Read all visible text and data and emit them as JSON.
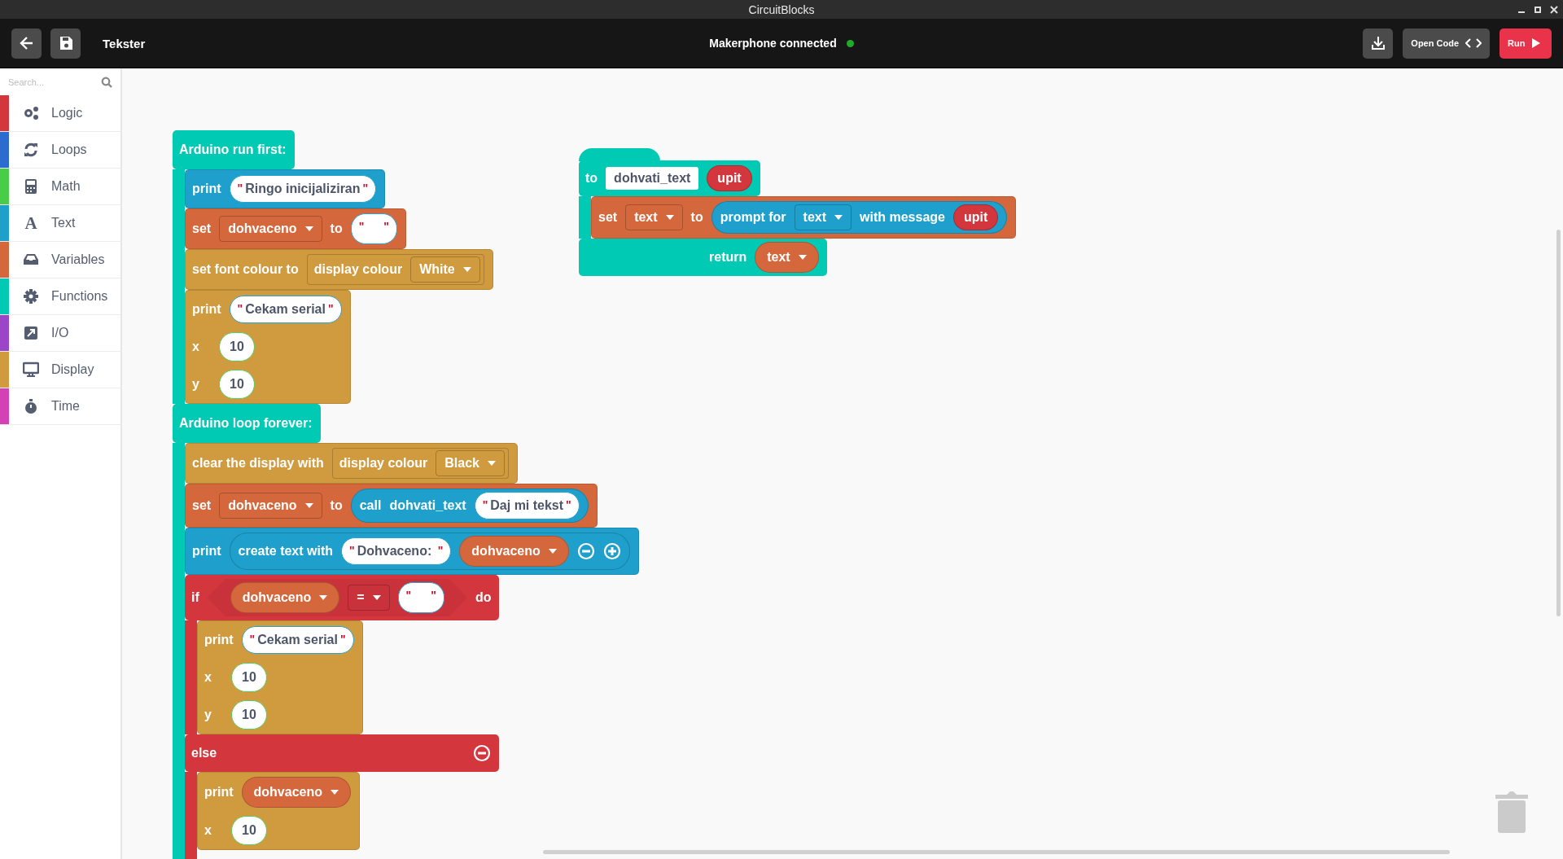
{
  "window": {
    "title": "CircuitBlocks"
  },
  "toolbar": {
    "project_name": "Tekster",
    "status": "Makerphone connected",
    "connected": true,
    "buttons": [
      {
        "kind": "open_code",
        "label": "Open Code"
      },
      {
        "kind": "run",
        "label": "Run"
      }
    ]
  },
  "sidebar": {
    "search": {
      "placeholder": "Search..."
    },
    "categories": [
      {
        "kind": "logic",
        "label": "Logic",
        "color": "#d3363d"
      },
      {
        "kind": "loops",
        "label": "Loops",
        "color": "#2d6ccf"
      },
      {
        "kind": "math",
        "label": "Math",
        "color": "#49cc47"
      },
      {
        "kind": "text",
        "label": "Text",
        "glyph": "A",
        "color": "#1fa0cb"
      },
      {
        "kind": "variables",
        "label": "Variables",
        "color": "#d4683c"
      },
      {
        "kind": "functions",
        "label": "Functions",
        "color": "#00c9b4"
      },
      {
        "kind": "io",
        "label": "I/O",
        "color": "#9b45c9"
      },
      {
        "kind": "display",
        "label": "Display",
        "color": "#d09a3f"
      },
      {
        "kind": "time",
        "label": "Time",
        "color": "#d441b4"
      }
    ]
  },
  "workspace": {
    "stacks": [
      {
        "kind": "arduino",
        "rows": [
          {
            "kind": "line",
            "parts": [
              {
                "kind": "label",
                "text": "Arduino run first:"
              }
            ]
          },
          {
            "kind": "slot",
            "blocks": [
              {
                "kind": "text",
                "rows": [
                  {
                    "kind": "line",
                    "parts": [
                      {
                        "kind": "label",
                        "text": "print"
                      },
                      {
                        "kind": "string",
                        "open": "\"",
                        "value": "Ringo inicijaliziran",
                        "close": "\""
                      }
                    ]
                  }
                ]
              },
              {
                "kind": "variables",
                "rows": [
                  {
                    "kind": "line",
                    "parts": [
                      {
                        "kind": "label",
                        "text": "set"
                      },
                      {
                        "kind": "dropdown",
                        "text": "dohvaceno"
                      },
                      {
                        "kind": "label",
                        "text": "to"
                      },
                      {
                        "kind": "string",
                        "open": "\"",
                        "close": "\""
                      }
                    ]
                  }
                ]
              },
              {
                "kind": "display",
                "rows": [
                  {
                    "kind": "line",
                    "parts": [
                      {
                        "kind": "label",
                        "text": "set font colour to"
                      },
                      {
                        "kind": "display_reporter",
                        "parts": [
                          {
                            "kind": "label",
                            "text": "display colour"
                          },
                          {
                            "kind": "dropdown",
                            "text": "White"
                          }
                        ]
                      }
                    ]
                  }
                ]
              },
              {
                "kind": "display",
                "rows": [
                  {
                    "kind": "line",
                    "parts": [
                      {
                        "kind": "label",
                        "text": "print"
                      },
                      {
                        "kind": "string",
                        "open": "\"",
                        "value": "Cekam serial",
                        "close": "\""
                      }
                    ]
                  },
                  {
                    "kind": "line",
                    "parts": [
                      {
                        "kind": "label",
                        "text": "x"
                      },
                      {
                        "kind": "number",
                        "text": "10"
                      }
                    ]
                  },
                  {
                    "kind": "line",
                    "parts": [
                      {
                        "kind": "label",
                        "text": "y"
                      },
                      {
                        "kind": "number",
                        "text": "10"
                      }
                    ]
                  }
                ]
              }
            ]
          },
          {
            "kind": "line",
            "parts": [
              {
                "kind": "label",
                "text": "Arduino loop forever:"
              }
            ]
          },
          {
            "kind": "slot",
            "blocks": [
              {
                "kind": "display",
                "rows": [
                  {
                    "kind": "line",
                    "parts": [
                      {
                        "kind": "label",
                        "text": "clear the display with"
                      },
                      {
                        "kind": "display_reporter",
                        "parts": [
                          {
                            "kind": "label",
                            "text": "display colour"
                          },
                          {
                            "kind": "dropdown",
                            "text": "Black"
                          }
                        ]
                      }
                    ]
                  }
                ]
              },
              {
                "kind": "variables",
                "rows": [
                  {
                    "kind": "line",
                    "parts": [
                      {
                        "kind": "label",
                        "text": "set"
                      },
                      {
                        "kind": "dropdown",
                        "text": "dohvaceno"
                      },
                      {
                        "kind": "label",
                        "text": "to"
                      },
                      {
                        "kind": "text_reporter",
                        "parts": [
                          {
                            "kind": "label",
                            "text": "call"
                          },
                          {
                            "kind": "label",
                            "text": "dohvati_text"
                          },
                          {
                            "kind": "string",
                            "open": "\"",
                            "value": "Daj mi tekst",
                            "close": "\""
                          }
                        ]
                      }
                    ]
                  }
                ]
              },
              {
                "kind": "text",
                "rows": [
                  {
                    "kind": "line",
                    "parts": [
                      {
                        "kind": "label",
                        "text": "print"
                      },
                      {
                        "kind": "text_reporter",
                        "parts": [
                          {
                            "kind": "label",
                            "text": "create text with"
                          },
                          {
                            "kind": "string",
                            "open": "\"",
                            "value": "Dohvaceno: ",
                            "close": "\""
                          },
                          {
                            "kind": "variable",
                            "text": "dohvaceno"
                          },
                          {
                            "kind": "minus"
                          },
                          {
                            "kind": "plus"
                          }
                        ]
                      }
                    ]
                  }
                ]
              },
              {
                "kind": "logic",
                "rows": [
                  {
                    "kind": "line",
                    "parts": [
                      {
                        "kind": "label",
                        "text": "if"
                      },
                      {
                        "kind": "condition",
                        "parts": [
                          {
                            "kind": "variable",
                            "text": "dohvaceno"
                          },
                          {
                            "kind": "dropdown",
                            "text": "="
                          },
                          {
                            "kind": "string",
                            "open": "\"",
                            "close": "\""
                          }
                        ]
                      },
                      {
                        "kind": "label",
                        "text": "do"
                      }
                    ]
                  },
                  {
                    "kind": "slot",
                    "blocks": [
                      {
                        "kind": "display",
                        "rows": [
                          {
                            "kind": "line",
                            "parts": [
                              {
                                "kind": "label",
                                "text": "print"
                              },
                              {
                                "kind": "string",
                                "open": "\"",
                                "value": "Cekam serial",
                                "close": "\""
                              }
                            ]
                          },
                          {
                            "kind": "line",
                            "parts": [
                              {
                                "kind": "label",
                                "text": "x"
                              },
                              {
                                "kind": "number",
                                "text": "10"
                              }
                            ]
                          },
                          {
                            "kind": "line",
                            "parts": [
                              {
                                "kind": "label",
                                "text": "y"
                              },
                              {
                                "kind": "number",
                                "text": "10"
                              }
                            ]
                          }
                        ]
                      }
                    ]
                  },
                  {
                    "kind": "line",
                    "parts": [
                      {
                        "kind": "label",
                        "text": "else"
                      },
                      {
                        "kind": "minus"
                      }
                    ]
                  },
                  {
                    "kind": "slot",
                    "blocks": [
                      {
                        "kind": "display",
                        "rows": [
                          {
                            "kind": "line",
                            "parts": [
                              {
                                "kind": "label",
                                "text": "print"
                              },
                              {
                                "kind": "variable",
                                "text": "dohvaceno"
                              }
                            ]
                          },
                          {
                            "kind": "line",
                            "parts": [
                              {
                                "kind": "label",
                                "text": "x"
                              },
                              {
                                "kind": "number",
                                "text": "10"
                              }
                            ]
                          }
                        ]
                      }
                    ]
                  }
                ]
              }
            ]
          }
        ]
      },
      {
        "kind": "functions",
        "hat": true,
        "rows": [
          {
            "kind": "line",
            "parts": [
              {
                "kind": "label",
                "text": "to"
              },
              {
                "kind": "name_field",
                "text": "dohvati_text"
              },
              {
                "kind": "argument",
                "text": "upit"
              }
            ]
          },
          {
            "kind": "slot",
            "blocks": [
              {
                "kind": "variables",
                "rows": [
                  {
                    "kind": "line",
                    "parts": [
                      {
                        "kind": "label",
                        "text": "set"
                      },
                      {
                        "kind": "dropdown",
                        "text": "text"
                      },
                      {
                        "kind": "label",
                        "text": "to"
                      },
                      {
                        "kind": "text_reporter",
                        "parts": [
                          {
                            "kind": "label",
                            "text": "prompt for"
                          },
                          {
                            "kind": "dropdown",
                            "text": "text"
                          },
                          {
                            "kind": "label",
                            "text": "with message"
                          },
                          {
                            "kind": "argument",
                            "text": "upit"
                          }
                        ]
                      }
                    ]
                  }
                ]
              }
            ]
          },
          {
            "kind": "footer",
            "parts": [
              {
                "kind": "label",
                "text": "return"
              },
              {
                "kind": "variable",
                "text": "text"
              }
            ]
          }
        ]
      }
    ]
  }
}
